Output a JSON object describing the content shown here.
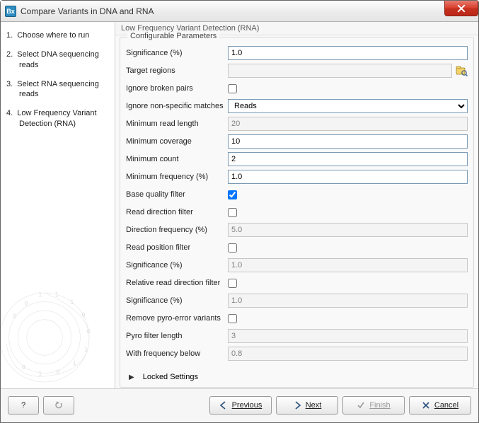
{
  "window": {
    "title": "Compare Variants in DNA and RNA",
    "app_icon_text": "Bx"
  },
  "sidebar": {
    "steps": [
      "Choose where to run",
      "Select DNA sequencing reads",
      "Select RNA sequencing reads",
      "Low Frequency Variant Detection (RNA)"
    ]
  },
  "section": {
    "header": "Low Frequency Variant Detection (RNA)",
    "group_title": "Configurable Parameters",
    "locked_label": "Locked Settings"
  },
  "params": {
    "significance1": {
      "label": "Significance (%)",
      "value": "1.0",
      "disabled": false
    },
    "target_regions": {
      "label": "Target regions",
      "value": "",
      "disabled": true
    },
    "ignore_broken_pairs": {
      "label": "Ignore broken pairs",
      "checked": false
    },
    "ignore_nonspecific": {
      "label": "Ignore non-specific matches",
      "value": "Reads",
      "options": [
        "Reads"
      ]
    },
    "min_read_length": {
      "label": "Minimum read length",
      "value": "20",
      "disabled": true
    },
    "min_coverage": {
      "label": "Minimum coverage",
      "value": "10",
      "disabled": false
    },
    "min_count": {
      "label": "Minimum count",
      "value": "2",
      "disabled": false
    },
    "min_frequency": {
      "label": "Minimum frequency (%)",
      "value": "1.0",
      "disabled": false
    },
    "base_quality_filter": {
      "label": "Base quality filter",
      "checked": true
    },
    "read_direction_filter": {
      "label": "Read direction filter",
      "checked": false
    },
    "direction_frequency": {
      "label": "Direction frequency (%)",
      "value": "5.0",
      "disabled": true
    },
    "read_position_filter": {
      "label": "Read position filter",
      "checked": false
    },
    "significance2": {
      "label": "Significance (%)",
      "value": "1.0",
      "disabled": true
    },
    "relative_read_dir_filter": {
      "label": "Relative read direction filter",
      "checked": false
    },
    "significance3": {
      "label": "Significance (%)",
      "value": "1.0",
      "disabled": true
    },
    "remove_pyro": {
      "label": "Remove pyro-error variants",
      "checked": false
    },
    "pyro_filter_length": {
      "label": "Pyro filter length",
      "value": "3",
      "disabled": true
    },
    "with_freq_below": {
      "label": "With frequency below",
      "value": "0.8",
      "disabled": true
    }
  },
  "buttons": {
    "help": "?",
    "previous": "Previous",
    "next": "Next",
    "finish": "Finish",
    "cancel": "Cancel"
  }
}
